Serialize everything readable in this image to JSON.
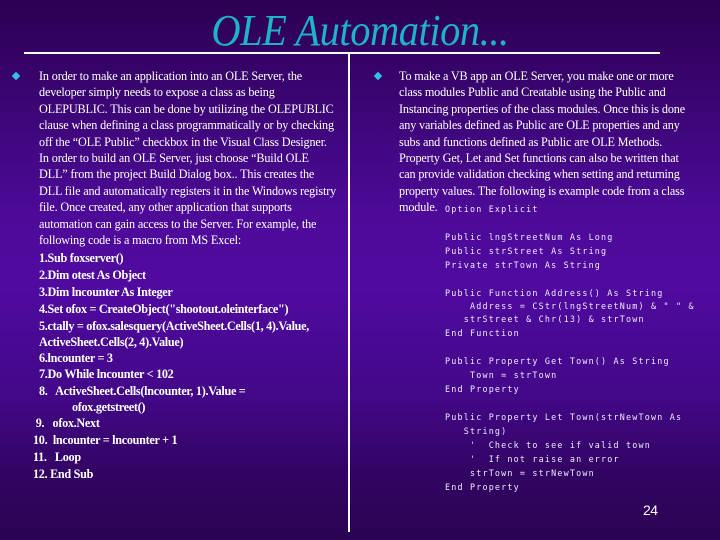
{
  "slide": {
    "title": "OLE Automation...",
    "page_number": "24",
    "colors": {
      "title": "#1fb3c8",
      "bullet": "#35c0e6",
      "text": "#ffffff",
      "background_top": "#2c0052",
      "background_middle": "#500aa0",
      "background_bottom": "#2a0352",
      "rules": "#ffffff"
    }
  },
  "left_column": {
    "bullet_icon": "diamond-bullet",
    "paragraph": "In order to make an application into an OLE Server, the developer simply needs to expose a class as being OLEPUBLIC. This can be done by utilizing the OLEPUBLIC clause when defining a class programmatically or by checking off the “OLE Public” checkbox in the Visual Class Designer. In order to build an OLE Server, just choose “Build OLE DLL” from the project Build Dialog box.. This creates the DLL file and automatically registers it in the Windows registry file. Once created, any other application that supports automation can gain access to the Server. For example, the following code is a macro from MS Excel:",
    "code_lines": [
      "1.Sub foxserver()",
      "2.Dim otest As Object",
      "3.Dim lncounter As Integer",
      "4.Set ofox = CreateObject(\"shootout.oleinterface\")",
      "5.ctally = ofox.salesquery(ActiveSheet.Cells(1, 4).Value,",
      "ActiveSheet.Cells(2, 4).Value)",
      "6.lncounter = 3",
      "7.Do While lncounter < 102",
      "8.   ActiveSheet.Cells(lncounter, 1).Value =",
      "            ofox.getstreet()",
      " 9.   ofox.Next",
      "10.  lncounter = lncounter + 1",
      "11.   Loop",
      "12. End Sub"
    ]
  },
  "right_column": {
    "bullet_icon": "diamond-bullet",
    "paragraph": "To make a VB app an OLE Server, you make one or more class modules Public and Creatable using the Public and Instancing properties of the class modules.  Once this is done any variables defined as Public are OLE properties and any subs and functions defined as Public are OLE Methods.  Property Get, Let and Set functions can also be written that can provide validation checking when setting and returning property values.  The following is example code from a class module.",
    "code_lines": [
      "Option Explicit",
      "",
      "Public lngStreetNum As Long",
      "Public strStreet As String",
      "Private strTown As String",
      "",
      "Public Function Address() As String",
      "    Address = CStr(lngStreetNum) & \" \" &",
      "   strStreet & Chr(13) & strTown",
      "End Function",
      "",
      "Public Property Get Town() As String",
      "    Town = strTown",
      "End Property",
      "",
      "Public Property Let Town(strNewTown As",
      "   String)",
      "    '  Check to see if valid town",
      "    '  If not raise an error",
      "    strTown = strNewTown",
      "End Property"
    ]
  }
}
